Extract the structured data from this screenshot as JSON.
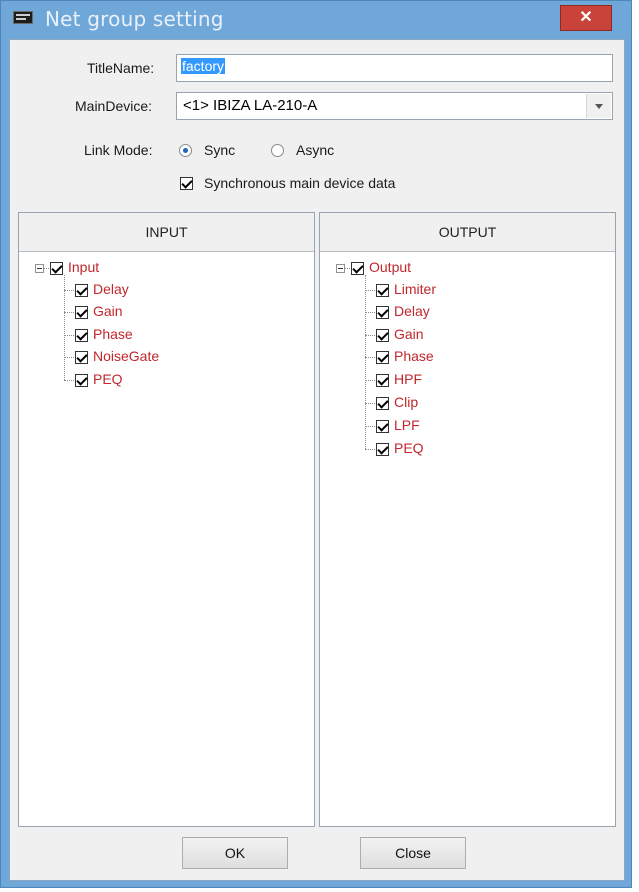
{
  "window": {
    "title": "Net group setting",
    "close_glyph": "✕"
  },
  "form": {
    "title_name_label": "TitleName:",
    "title_name_value": "factory",
    "main_device_label": "MainDevice:",
    "main_device_value": "<1> IBIZA LA-210-A",
    "link_mode_label": "Link Mode:",
    "link_mode_options": [
      {
        "label": "Sync",
        "selected": true
      },
      {
        "label": "Async",
        "selected": false
      }
    ],
    "sync_main_label": "Synchronous main device data",
    "sync_main_checked": true
  },
  "input_panel": {
    "header": "INPUT",
    "root": "Input",
    "children": [
      "Delay",
      "Gain",
      "Phase",
      "NoiseGate",
      "PEQ"
    ]
  },
  "output_panel": {
    "header": "OUTPUT",
    "root": "Output",
    "children": [
      "Limiter",
      "Delay",
      "Gain",
      "Phase",
      "HPF",
      "Clip",
      "LPF",
      "PEQ"
    ]
  },
  "buttons": {
    "ok": "OK",
    "close": "Close"
  },
  "colors": {
    "tree_label": "#c1272d",
    "title_bar": "#6fa7d8",
    "close_button": "#c9433a"
  },
  "icons": {
    "app": "app-icon",
    "combo": "chevron-down-icon",
    "tree_toggle": "collapse-icon"
  }
}
